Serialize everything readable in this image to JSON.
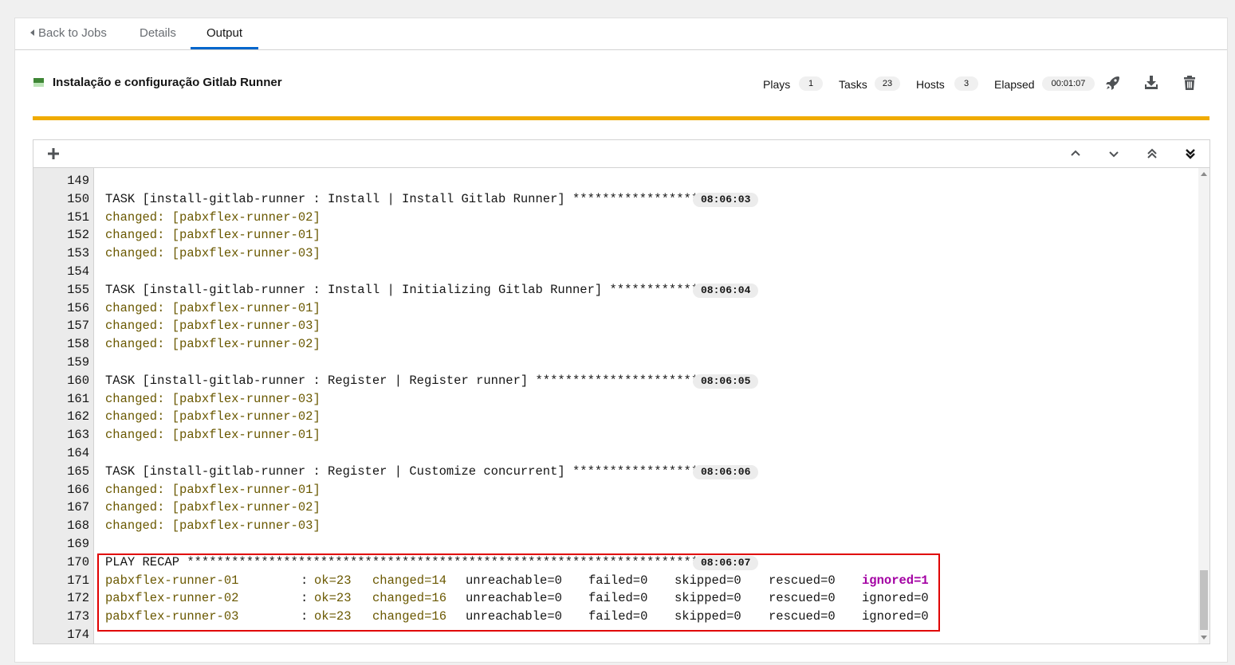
{
  "tabs": {
    "back": "Back to Jobs",
    "details": "Details",
    "output": "Output"
  },
  "job": {
    "title": "Instalação e configuração Gitlab Runner",
    "status_color": "#3e8635",
    "progress_color": "#f0ab00"
  },
  "stats": {
    "plays_label": "Plays",
    "plays": "1",
    "tasks_label": "Tasks",
    "tasks": "23",
    "hosts_label": "Hosts",
    "hosts": "3",
    "elapsed_label": "Elapsed",
    "elapsed": "00:01:07"
  },
  "toolbar_icons": [
    "rocket-icon",
    "download-icon",
    "trash-icon"
  ],
  "output_toolbar_icons": [
    "plus-icon",
    "chevron-up-icon",
    "chevron-down-icon",
    "double-chevron-up-icon",
    "double-chevron-down-icon"
  ],
  "lines": [
    {
      "n": "149",
      "text": ""
    },
    {
      "n": "150",
      "text": "TASK [install-gitlab-runner : Install | Install Gitlab Runner] *****************",
      "ts": "08:06:03"
    },
    {
      "n": "151",
      "text": "changed: [pabxflex-runner-02]",
      "kind": "changed"
    },
    {
      "n": "152",
      "text": "changed: [pabxflex-runner-01]",
      "kind": "changed"
    },
    {
      "n": "153",
      "text": "changed: [pabxflex-runner-03]",
      "kind": "changed"
    },
    {
      "n": "154",
      "text": ""
    },
    {
      "n": "155",
      "text": "TASK [install-gitlab-runner : Install | Initializing Gitlab Runner] ************",
      "ts": "08:06:04"
    },
    {
      "n": "156",
      "text": "changed: [pabxflex-runner-01]",
      "kind": "changed"
    },
    {
      "n": "157",
      "text": "changed: [pabxflex-runner-03]",
      "kind": "changed"
    },
    {
      "n": "158",
      "text": "changed: [pabxflex-runner-02]",
      "kind": "changed"
    },
    {
      "n": "159",
      "text": ""
    },
    {
      "n": "160",
      "text": "TASK [install-gitlab-runner : Register | Register runner] **********************",
      "ts": "08:06:05"
    },
    {
      "n": "161",
      "text": "changed: [pabxflex-runner-03]",
      "kind": "changed"
    },
    {
      "n": "162",
      "text": "changed: [pabxflex-runner-02]",
      "kind": "changed"
    },
    {
      "n": "163",
      "text": "changed: [pabxflex-runner-01]",
      "kind": "changed"
    },
    {
      "n": "164",
      "text": ""
    },
    {
      "n": "165",
      "text": "TASK [install-gitlab-runner : Register | Customize concurrent] *****************",
      "ts": "08:06:06"
    },
    {
      "n": "166",
      "text": "changed: [pabxflex-runner-01]",
      "kind": "changed"
    },
    {
      "n": "167",
      "text": "changed: [pabxflex-runner-02]",
      "kind": "changed"
    },
    {
      "n": "168",
      "text": "changed: [pabxflex-runner-03]",
      "kind": "changed"
    },
    {
      "n": "169",
      "text": ""
    },
    {
      "n": "170",
      "text": "PLAY RECAP *********************************************************************",
      "ts": "08:06:07"
    }
  ],
  "recap": [
    {
      "n": "171",
      "host": "pabxflex-runner-01",
      "ok": "ok=23",
      "changed": "changed=14",
      "unreachable": "unreachable=0",
      "failed": "failed=0",
      "skipped": "skipped=0",
      "rescued": "rescued=0",
      "ignored": "ignored=1"
    },
    {
      "n": "172",
      "host": "pabxflex-runner-02",
      "ok": "ok=23",
      "changed": "changed=16",
      "unreachable": "unreachable=0",
      "failed": "failed=0",
      "skipped": "skipped=0",
      "rescued": "rescued=0",
      "ignored": "ignored=0"
    },
    {
      "n": "173",
      "host": "pabxflex-runner-03",
      "ok": "ok=23",
      "changed": "changed=16",
      "unreachable": "unreachable=0",
      "failed": "failed=0",
      "skipped": "skipped=0",
      "rescued": "rescued=0",
      "ignored": "ignored=0"
    }
  ],
  "last_line": {
    "n": "174",
    "text": ""
  },
  "recap_separator": ":"
}
